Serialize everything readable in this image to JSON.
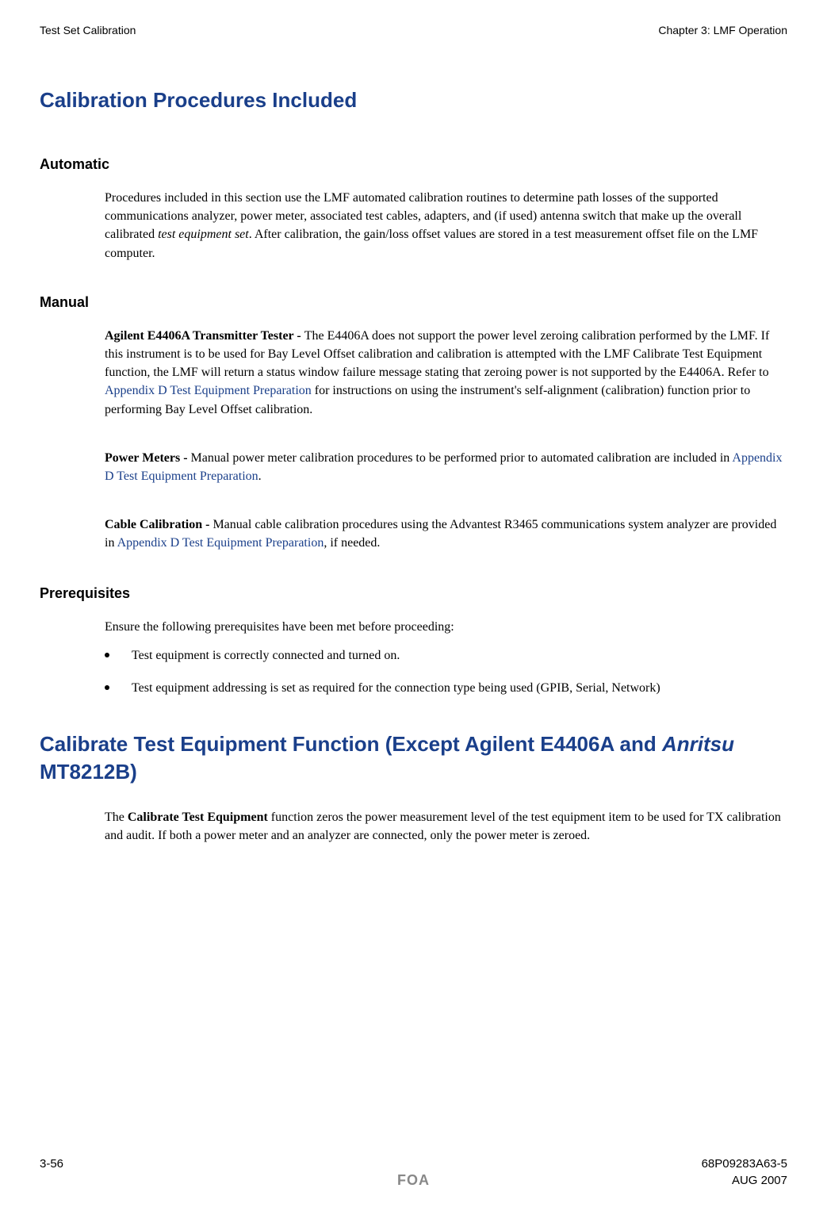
{
  "header": {
    "left": "Test Set Calibration",
    "right": "Chapter 3: LMF Operation"
  },
  "h1_main": "Calibration Procedures Included",
  "automatic": {
    "heading": "Automatic",
    "para_pre": "Procedures included in this section use the LMF automated calibration routines to determine path losses of the supported communications analyzer, power meter, associated test cables, adapters, and (if used) antenna switch that make up the overall calibrated ",
    "italic": "test equipment set",
    "para_post": ". After calibration, the gain/loss offset values are stored in a test measurement offset file on the LMF computer."
  },
  "manual": {
    "heading": "Manual",
    "agilent": {
      "bold": "Agilent E4406A Transmitter Tester - ",
      "text_pre": "The E4406A does not support the power level zeroing calibration performed by the LMF. If this instrument is to be used for Bay Level Offset calibration and calibration is attempted with the LMF Calibrate Test Equipment function, the LMF will return a status window failure message stating that zeroing power is not supported by the E4406A. Refer to ",
      "link": "Appendix D Test Equipment Preparation",
      "text_post": " for instructions on using the instrument's self-alignment (calibration) function prior to performing Bay Level Offset calibration."
    },
    "power": {
      "bold": "Power Meters - ",
      "text_pre": "Manual power meter calibration procedures to be performed prior to automated calibration are included in ",
      "link": "Appendix D Test Equipment Preparation",
      "text_post": "."
    },
    "cable": {
      "bold": "Cable Calibration - ",
      "text_pre": "Manual cable calibration procedures using the Advantest R3465 communications system analyzer are provided in ",
      "link": "Appendix D Test Equipment Preparation",
      "text_post": ", if needed."
    }
  },
  "prereq": {
    "heading": "Prerequisites",
    "intro": "Ensure the following prerequisites have been met before proceeding:",
    "items": [
      "Test equipment is correctly connected and turned on.",
      "Test equipment addressing is set as required for the connection type being used (GPIB, Serial, Network)"
    ]
  },
  "calibrate": {
    "heading_pre": "Calibrate Test Equipment Function (Except Agilent E4406A and ",
    "heading_italic": "Anritsu",
    "heading_post": " MT8212B)",
    "para_pre": "The ",
    "para_bold": "Calibrate Test Equipment",
    "para_post": " function zeros the power measurement level of the test equipment item to be used for TX calibration and audit. If both a power meter and an analyzer are connected, only the power meter is zeroed."
  },
  "footer": {
    "page": "3-56",
    "doc": "68P09283A63-5",
    "foa": "FOA",
    "date": "AUG 2007"
  }
}
